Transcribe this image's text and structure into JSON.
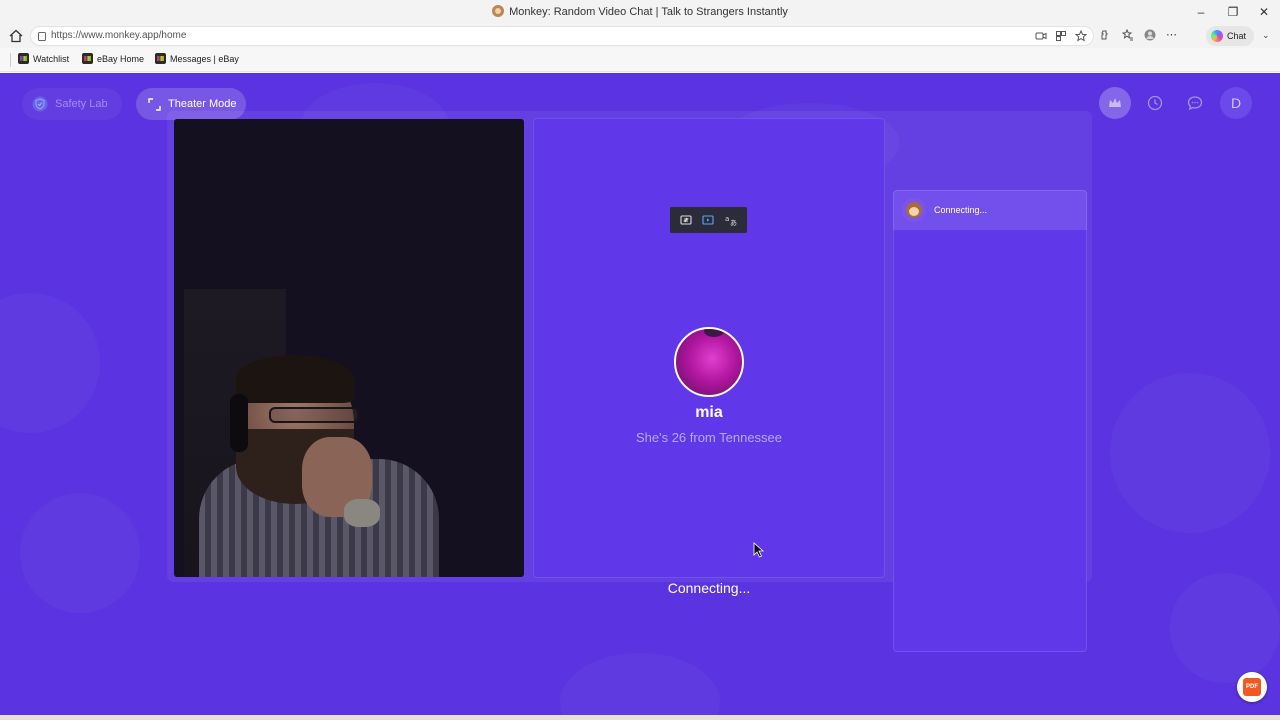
{
  "browser": {
    "window_title": "Monkey: Random Video Chat | Talk to Strangers Instantly",
    "url": "https://www.monkey.app/home",
    "chat_button_label": "Chat",
    "bookmarks": [
      {
        "label": "Watchlist",
        "icon": "ebay-icon"
      },
      {
        "label": "eBay Home",
        "icon": "ebay-icon"
      },
      {
        "label": "Messages | eBay",
        "icon": "ebay-icon"
      }
    ]
  },
  "header": {
    "safety_label": "Safety Lab",
    "theater_label": "Theater Mode",
    "avatar_initial": "D",
    "icons": [
      "crown-icon",
      "history-icon",
      "message-icon"
    ]
  },
  "stranger": {
    "name": "mia",
    "info": "She's 26 from Tennessee",
    "status": "Connecting..."
  },
  "chat": {
    "status_text": "Connecting..."
  },
  "pdf_badge": "PDF",
  "colors": {
    "page_bg": "#5b33e0",
    "panel_bg": "#6038ea",
    "accent_white": "#ffffff"
  }
}
